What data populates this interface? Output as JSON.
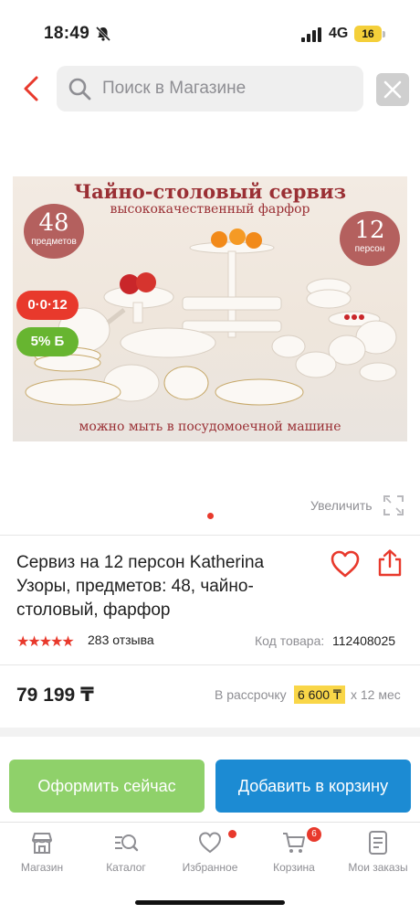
{
  "status_bar": {
    "time": "18:49",
    "network": "4G",
    "battery": "16",
    "icons": [
      "bell-slash-icon",
      "signal-icon",
      "battery-icon"
    ]
  },
  "header": {
    "search_placeholder": "Поиск в Магазине",
    "icons": [
      "chevron-left-icon",
      "search-icon",
      "close-icon"
    ]
  },
  "product_image": {
    "title": "Чайно-столовый сервиз",
    "subtitle": "высококачественный фарфор",
    "badge_left_number": "48",
    "badge_left_label": "предметов",
    "badge_right_number": "12",
    "badge_right_label": "персон",
    "footer": "можно мыть в посудомоечной машине",
    "promo_installment": "0·0·12",
    "promo_bonus": "5% Б",
    "enlarge_label": "Увеличить",
    "slides_total": 1,
    "current_slide": 1
  },
  "product": {
    "title": "Сервиз на 12 персон Katherina Узоры, предметов: 48, чайно-столовый, фарфор",
    "rating": 5,
    "reviews": "283 отзыва",
    "sku_label": "Код товара:",
    "sku": "112408025",
    "price": "79 199 ₸",
    "installment_text": "В рассрочку",
    "installment_amount": "6 600 ₸",
    "installment_term": "x 12 мес"
  },
  "actions": {
    "checkout_label": "Оформить сейчас",
    "add_to_cart_label": "Добавить в корзину"
  },
  "tab_bar": {
    "items": [
      {
        "label": "Магазин",
        "icon": "store-icon"
      },
      {
        "label": "Каталог",
        "icon": "catalog-search-icon"
      },
      {
        "label": "Избранное",
        "icon": "heart-icon"
      },
      {
        "label": "Корзина",
        "icon": "cart-icon",
        "badge": "6"
      },
      {
        "label": "Мои заказы",
        "icon": "orders-icon"
      }
    ]
  },
  "colors": {
    "accent_red": "#e8392c",
    "green_button": "#8fd16a",
    "blue_button": "#1c8bd3",
    "installment_highlight": "#f9d648"
  }
}
